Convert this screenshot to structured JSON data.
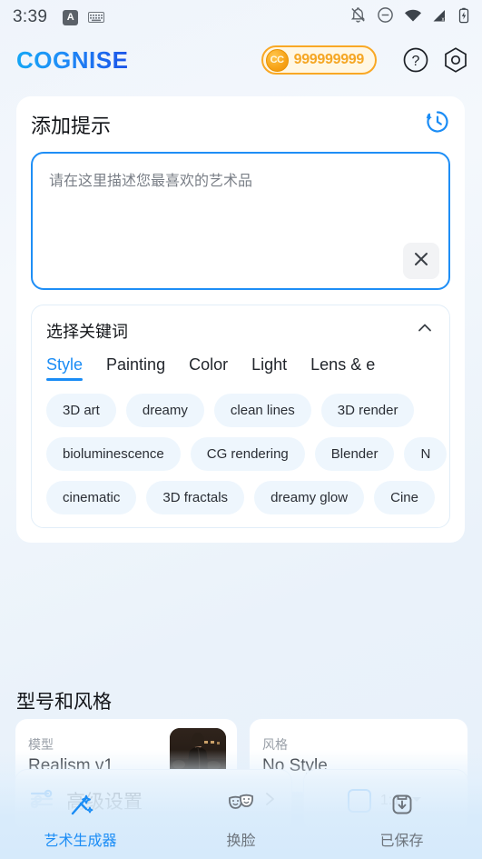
{
  "statusbar": {
    "time": "3:39",
    "left_icons": [
      "app-badge-a-icon",
      "keyboard-icon"
    ],
    "right_icons": [
      "bell-off-icon",
      "do-not-disturb-icon",
      "wifi-icon",
      "cellular-signal-off-icon",
      "battery-charging-icon"
    ]
  },
  "header": {
    "logo": "COGNISE",
    "coin": {
      "icon_label": "CC",
      "count": "999999999"
    },
    "help_icon": "help-circle-icon",
    "settings_icon": "settings-hexagon-icon"
  },
  "prompt_card": {
    "title": "添加提示",
    "history_icon": "history-icon",
    "textarea": {
      "value": "",
      "placeholder": "请在这里描述您最喜欢的艺术品"
    },
    "clear_icon": "close-icon"
  },
  "keywords": {
    "title": "选择关键词",
    "collapse_icon": "chevron-up-icon",
    "tabs": [
      {
        "label": "Style",
        "active": true
      },
      {
        "label": "Painting",
        "active": false
      },
      {
        "label": "Color",
        "active": false
      },
      {
        "label": "Light",
        "active": false
      },
      {
        "label": "Lens & e",
        "active": false
      }
    ],
    "rows": [
      [
        "3D art",
        "dreamy",
        "clean lines",
        "3D render"
      ],
      [
        "bioluminescence",
        "CG rendering",
        "Blender",
        "N"
      ],
      [
        "cinematic",
        "3D fractals",
        "dreamy glow",
        "Cine"
      ]
    ]
  },
  "model_style": {
    "section_title": "型号和风格",
    "model": {
      "label": "模型",
      "value": "Realism v1"
    },
    "style": {
      "label": "风格",
      "value": "No Style"
    }
  },
  "advanced": {
    "label": "高级设置",
    "sliders_icon": "sliders-icon",
    "chevron_icon": "chevron-right-icon",
    "ratio": {
      "value": "1:1",
      "icon": "aspect-ratio-icon",
      "dropdown_icon": "caret-down-icon"
    }
  },
  "bottom_nav": [
    {
      "label": "艺术生成器",
      "icon": "magic-wand-icon",
      "active": true
    },
    {
      "label": "换脸",
      "icon": "theater-masks-icon",
      "active": false
    },
    {
      "label": "已保存",
      "icon": "save-download-icon",
      "active": false
    }
  ],
  "colors": {
    "accent": "#1a8cf5",
    "coin": "#f5a623",
    "chip_bg": "#eef6fd",
    "page_bg": "#eff4fb"
  }
}
